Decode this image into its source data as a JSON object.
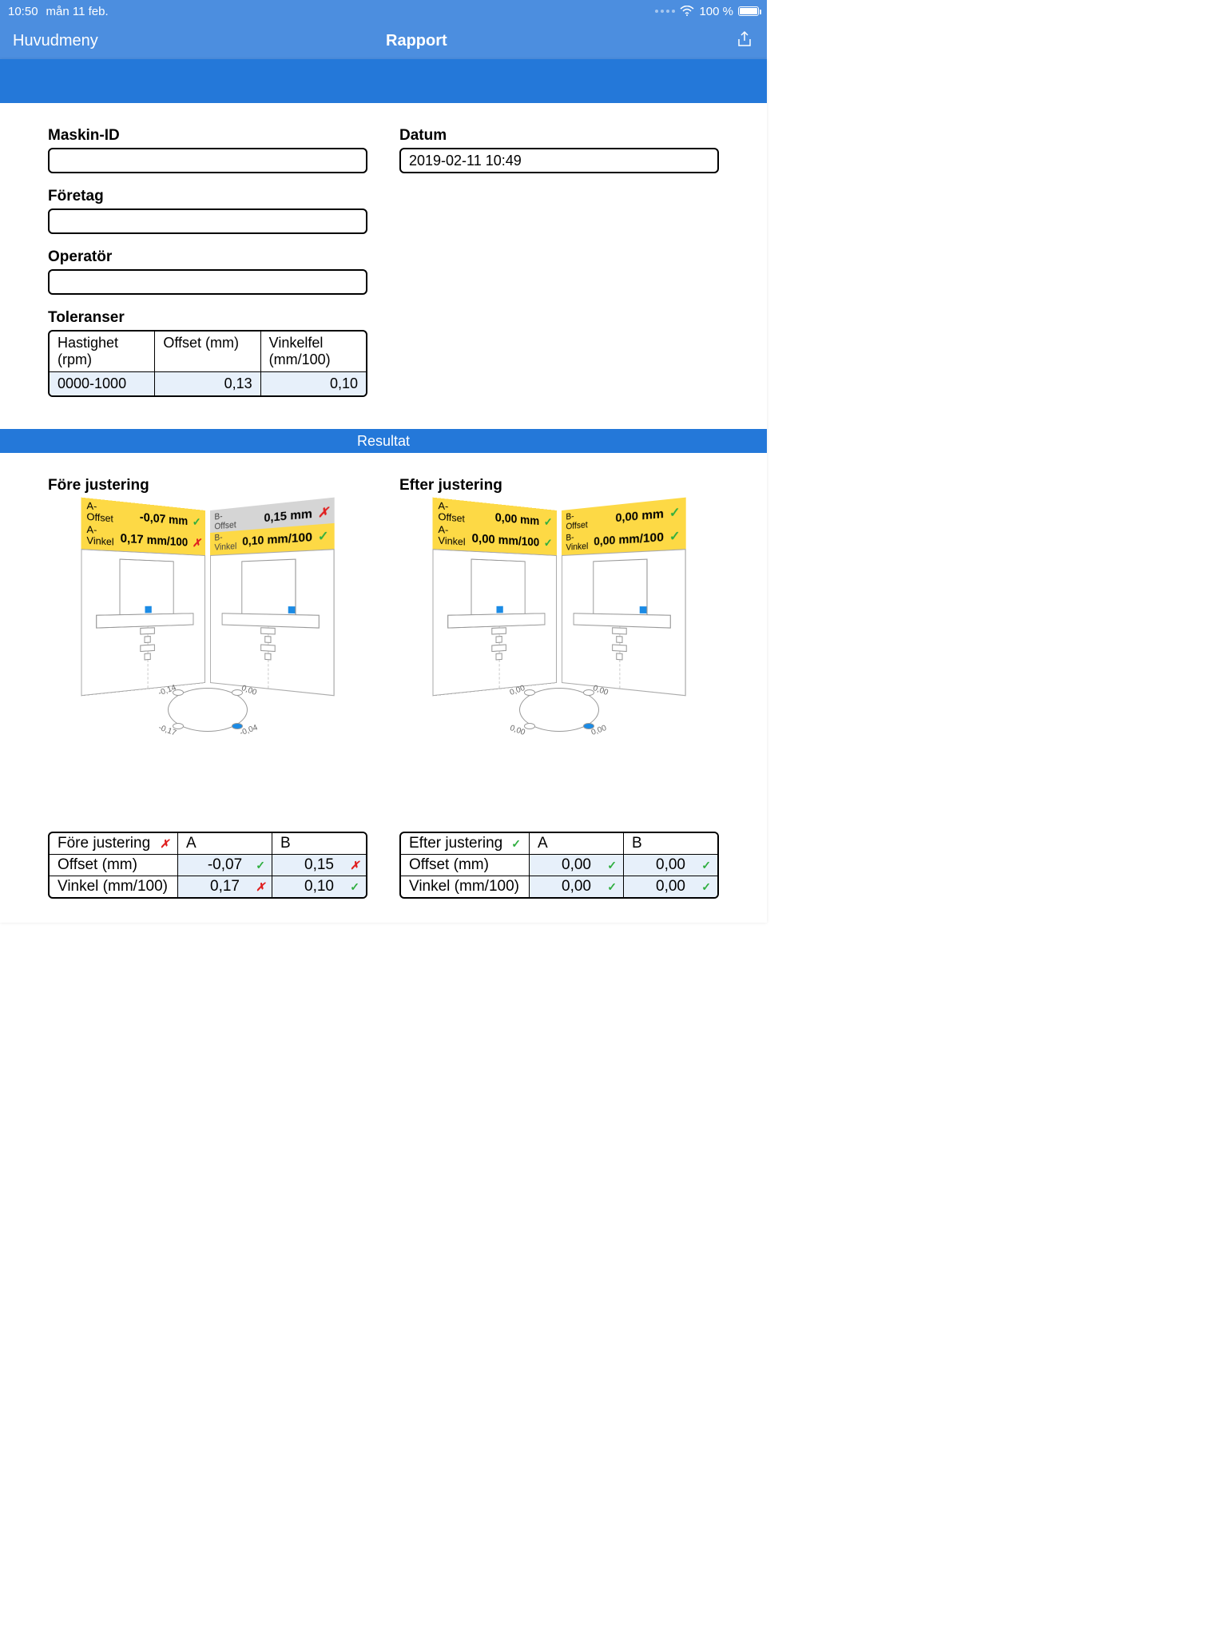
{
  "status": {
    "time": "10:50",
    "date": "mån 11 feb.",
    "battery": "100 %"
  },
  "nav": {
    "back": "Huvudmeny",
    "title": "Rapport"
  },
  "fields": {
    "maskin_id_label": "Maskin-ID",
    "maskin_id_value": "",
    "foretag_label": "Företag",
    "foretag_value": "",
    "operator_label": "Operatör",
    "operator_value": "",
    "datum_label": "Datum",
    "datum_value": "2019-02-11 10:49"
  },
  "tolerances": {
    "title": "Toleranser",
    "headers": {
      "speed": "Hastighet (rpm)",
      "offset": "Offset (mm)",
      "angle": "Vinkelfel (mm/100)"
    },
    "row": {
      "speed": "0000-1000",
      "offset": "0,13",
      "angle": "0,10"
    }
  },
  "result_bar": "Resultat",
  "before": {
    "title": "Före justering",
    "panelA": {
      "offset_label": "A-Offset",
      "offset_value": "-0,07 mm",
      "offset_ok": true,
      "angle_label": "A-Vinkel",
      "angle_value": "0,17 mm/100",
      "angle_ok": false
    },
    "panelB": {
      "offset_label": "B-Offset",
      "offset_value": "0,15 mm",
      "offset_ok": false,
      "angle_label": "B-Vinkel",
      "angle_value": "0,10 mm/100",
      "angle_ok": true
    },
    "feet": {
      "tl": "-0,14",
      "tr": "0,00",
      "bl": "-0,17",
      "br": "-0,04"
    },
    "table": {
      "title_ok": false,
      "a_label": "A",
      "b_label": "B",
      "offset_label": "Offset (mm)",
      "a_offset": "-0,07",
      "a_offset_ok": true,
      "b_offset": "0,15",
      "b_offset_ok": false,
      "angle_label": "Vinkel (mm/100)",
      "a_angle": "0,17",
      "a_angle_ok": false,
      "b_angle": "0,10",
      "b_angle_ok": true
    }
  },
  "after": {
    "title": "Efter justering",
    "panelA": {
      "offset_label": "A-Offset",
      "offset_value": "0,00 mm",
      "offset_ok": true,
      "angle_label": "A-Vinkel",
      "angle_value": "0,00 mm/100",
      "angle_ok": true
    },
    "panelB": {
      "offset_label": "B-Offset",
      "offset_value": "0,00 mm",
      "offset_ok": true,
      "angle_label": "B-Vinkel",
      "angle_value": "0,00 mm/100",
      "angle_ok": true
    },
    "feet": {
      "tl": "0,00",
      "tr": "0,00",
      "bl": "0,00",
      "br": "0,00"
    },
    "table": {
      "title_ok": true,
      "a_label": "A",
      "b_label": "B",
      "offset_label": "Offset (mm)",
      "a_offset": "0,00",
      "a_offset_ok": true,
      "b_offset": "0,00",
      "b_offset_ok": true,
      "angle_label": "Vinkel (mm/100)",
      "a_angle": "0,00",
      "a_angle_ok": true,
      "b_angle": "0,00",
      "b_angle_ok": true
    }
  }
}
